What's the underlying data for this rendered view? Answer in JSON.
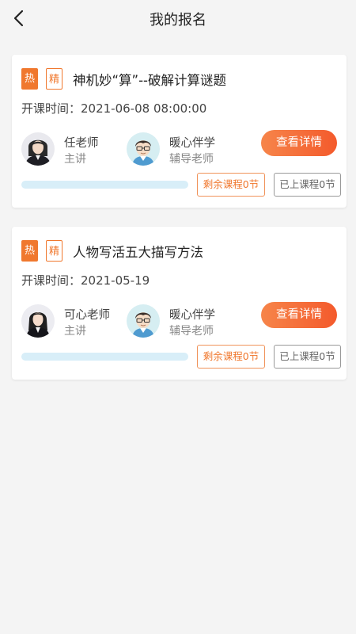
{
  "header": {
    "title": "我的报名"
  },
  "labels": {
    "start_prefix": "开课时间："
  },
  "colors": {
    "accent": "#f0782e",
    "progress_track": "#d8eef8",
    "background": "#f4f4f4"
  },
  "courses": [
    {
      "tag_hot": "热",
      "tag_fine": "精",
      "title": "神机妙“算”--破解计算谜题",
      "start_time": "开课时间：2021-06-08 08:00:00",
      "teacher": {
        "name": "任老师",
        "role": "主讲",
        "avatar_icon": "female-teacher-avatar"
      },
      "tutor": {
        "name": "暖心伴学",
        "role": "辅导老师",
        "avatar_icon": "male-cartoon-avatar"
      },
      "detail_button": "查看详情",
      "progress": 0,
      "remaining_label": "剩余课程0节",
      "attended_label": "已上课程0节"
    },
    {
      "tag_hot": "热",
      "tag_fine": "精",
      "title": "人物写活五大描写方法",
      "start_time": "开课时间：2021-05-19",
      "teacher": {
        "name": "可心老师",
        "role": "主讲",
        "avatar_icon": "female-teacher-avatar"
      },
      "tutor": {
        "name": "暖心伴学",
        "role": "辅导老师",
        "avatar_icon": "male-cartoon-avatar"
      },
      "detail_button": "查看详情",
      "progress": 0,
      "remaining_label": "剩余课程0节",
      "attended_label": "已上课程0节"
    }
  ]
}
